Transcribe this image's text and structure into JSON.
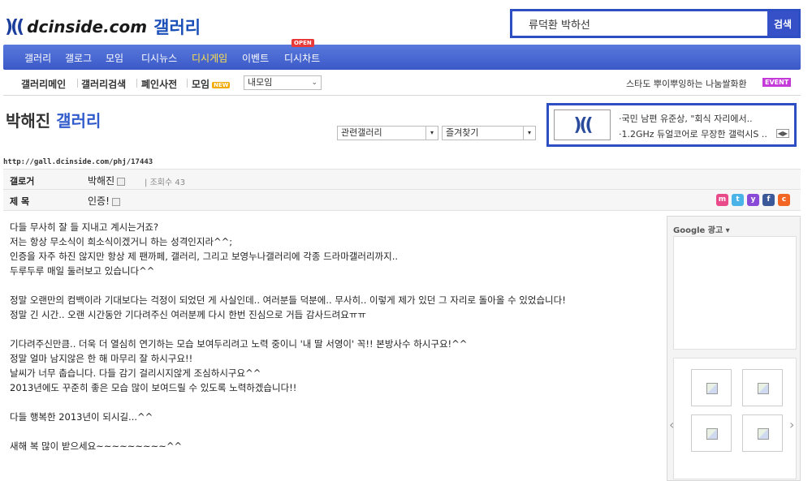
{
  "header": {
    "logo_mark": ")((",
    "logo_text": "dcinside.com",
    "logo_sub": "갤러리",
    "search_value": "류덕환 박하선",
    "search_button": "검색"
  },
  "nav": {
    "items": [
      "갤러리",
      "갤로그",
      "모임",
      "디시뉴스",
      "디시게임",
      "이벤트",
      "디시차트"
    ],
    "open_badge": "OPEN"
  },
  "subnav": {
    "items": [
      "갤러리메인",
      "갤러리검색",
      "폐인사전",
      "모임"
    ],
    "new_badge": "NEW",
    "my_select": "내모임",
    "promo": "스타도 뿌이뿌잉하는 나눔쌀화환",
    "event_badge": "EVENT"
  },
  "gallery": {
    "title_name": "박해진",
    "title_suffix": "갤러리",
    "related_select": "관련갤러리",
    "favorites_select": "즐겨찾기"
  },
  "ad_box": {
    "logo": ")((",
    "line1": "·국민 남편 유준상, \"회식 자리에서..",
    "line2": "·1.2GHz 듀얼코어로 무장한 갤럭시S ..",
    "nav": "◀▶"
  },
  "post": {
    "url": "http://gall.dcinside.com/phj/17443",
    "author_label": "갤로거",
    "author": "박해진",
    "views_label": "조회수",
    "views": "43",
    "title_label": "제 목",
    "title": "인증!",
    "share_icons": [
      "m",
      "t",
      "y",
      "f",
      "c"
    ],
    "share_colors": [
      "#e84a8a",
      "#4ab3e8",
      "#8a4ad8",
      "#3b5998",
      "#f26522"
    ],
    "paragraphs": [
      [
        "다들 무사히 잘 들 지내고 계시는거죠?",
        "저는 항상 무소식이 희소식이겠거니 하는 성격인지라^^;",
        "인증을 자주 하진 않지만 항상 제 팬까페, 갤러리, 그리고 보영누나갤러리에 각종 드라마갤러리까지..",
        "두루두루 매일 둘러보고 있습니다^^"
      ],
      [
        "정말 오랜만의 컴백이라 기대보다는 걱정이 되었던 게 사실인데.. 여러분들 덕분에.. 무사히.. 이렇게 제가 있던 그 자리로 돌아올 수 있었습니다!",
        "정말 긴 시간.. 오랜 시간동안 기다려주신 여러분께 다시 한번 진심으로 거듭 감사드려요ㅠㅠ"
      ],
      [
        "기다려주신만큼.. 더욱 더 열심히 연기하는 모습 보여두리려고 노력 중이니 '내 딸 서영이' 꼭!! 본방사수 하시구요!^^",
        "정말 얼마 남지않은 한 해 마무리 잘 하시구요!!",
        "날씨가 너무 춥습니다. 다들 감기 걸리시지않게 조심하시구요^^",
        "2013년에도 꾸준히 좋은 모습 많이 보여드릴 수 있도록 노력하겠습니다!!"
      ],
      [
        "다들 행복한 2013년이 되시길...^^"
      ],
      [
        "새해 복 많이 받으세요~~~~~~~~~^^"
      ]
    ]
  },
  "sidebar": {
    "google_label": "Google 광고 ▾"
  }
}
